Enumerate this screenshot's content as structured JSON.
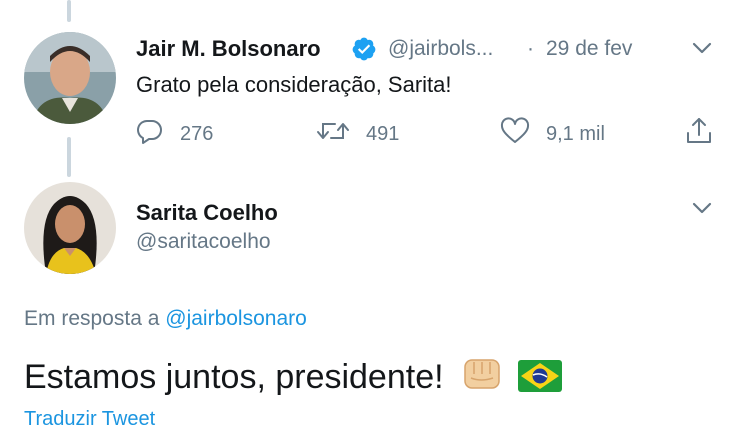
{
  "tweet1": {
    "author_name": "Jair M. Bolsonaro",
    "handle": "@jairbols...",
    "separator": "·",
    "date": "29 de fev",
    "text": "Grato pela consideração, Sarita!",
    "replies": "276",
    "retweets": "491",
    "likes": "9,1 mil"
  },
  "tweet2": {
    "author_name": "Sarita Coelho",
    "handle": "@saritacoelho",
    "reply_prefix": "Em resposta a",
    "reply_handle": "@jairbolsonaro",
    "text": "Estamos juntos, presidente!",
    "translate_label": "Traduzir Tweet"
  },
  "colors": {
    "accent": "#1b95e0",
    "verified": "#1da1f2",
    "muted": "#657786",
    "thread_line": "#cbd6de"
  }
}
